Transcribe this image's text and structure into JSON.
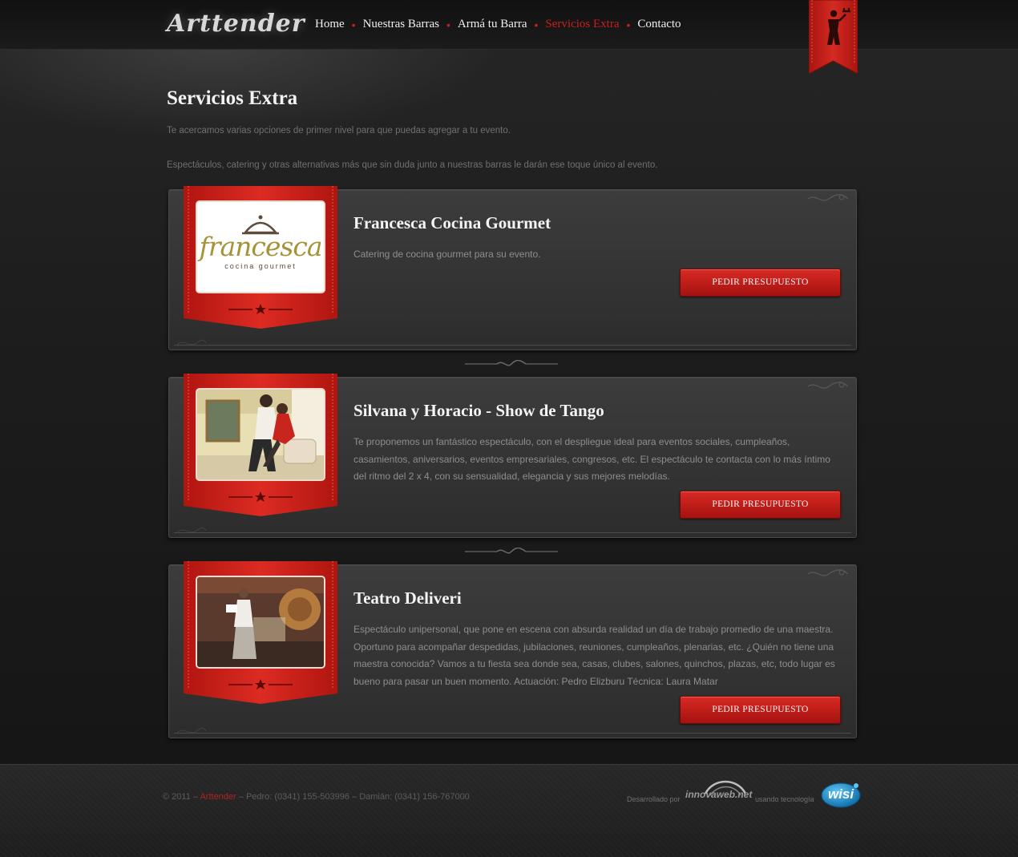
{
  "brand": {
    "logo_text": "Arttender"
  },
  "nav": {
    "items": [
      {
        "label": "Home",
        "active": false
      },
      {
        "label": "Nuestras Barras",
        "active": false
      },
      {
        "label": "Armá tu Barra",
        "active": false
      },
      {
        "label": "Servicios Extra",
        "active": true
      },
      {
        "label": "Contacto",
        "active": false
      }
    ],
    "separator": "•"
  },
  "page": {
    "title": "Servicios Extra",
    "intro": [
      "Te acercamos varias opciones de primer nivel para que puedas agregar a tu evento.",
      "Espectáculos, catering y otras alternativas más que sin duda junto a nuestras barras le darán ese toque único al evento."
    ]
  },
  "services": [
    {
      "title": "Francesca Cocina Gourmet",
      "description": "Catering de cocina gourmet para su evento.",
      "button": "PEDIR PRESUPUESTO",
      "logo_word": "francesca",
      "logo_sub": "cocina gourmet"
    },
    {
      "title": "Silvana y Horacio - Show de Tango",
      "description": "Te proponemos un fantástico espectáculo, con el despliegue ideal para eventos sociales, cumpleaños, casamientos, aniversarios, eventos empresariales, congresos, etc. El espectáculo te contacta con lo más íntimo del ritmo del 2 x 4, con su sensualidad, elegancia y sus mejores melodías.",
      "button": "PEDIR PRESUPUESTO"
    },
    {
      "title": "Teatro Deliveri",
      "description": "Espectáculo unipersonal, que pone en escena con absurda realidad un día de trabajo promedio de una maestra. Oportuno para acompañar despedidas, jubilaciones, reuniones, cumpleaños, plenarias, etc. ¿Quién no tiene una maestra conocida? Vamos a tu fiesta sea donde sea, casas, clubes, salones, quinchos, plazas, etc, todo lugar es bueno para pasar un buen momento. Actuación: Pedro Elizburu Técnica: Laura Matar",
      "button": "PEDIR PRESUPUESTO"
    }
  ],
  "footer": {
    "copyright_prefix": "© 2011 –",
    "brand": "Arttender",
    "contacts": "– Pedro: (0341) 155-503996 – Damián: (0341) 156-767000",
    "developed_by": "Desarrollado por",
    "developer": "innovaweb.net",
    "tech_label": "usando tecnología",
    "tech_brand": "wisi"
  },
  "colors": {
    "accent": "#c8201c",
    "background": "#1a1a1a",
    "card": "#363636"
  }
}
